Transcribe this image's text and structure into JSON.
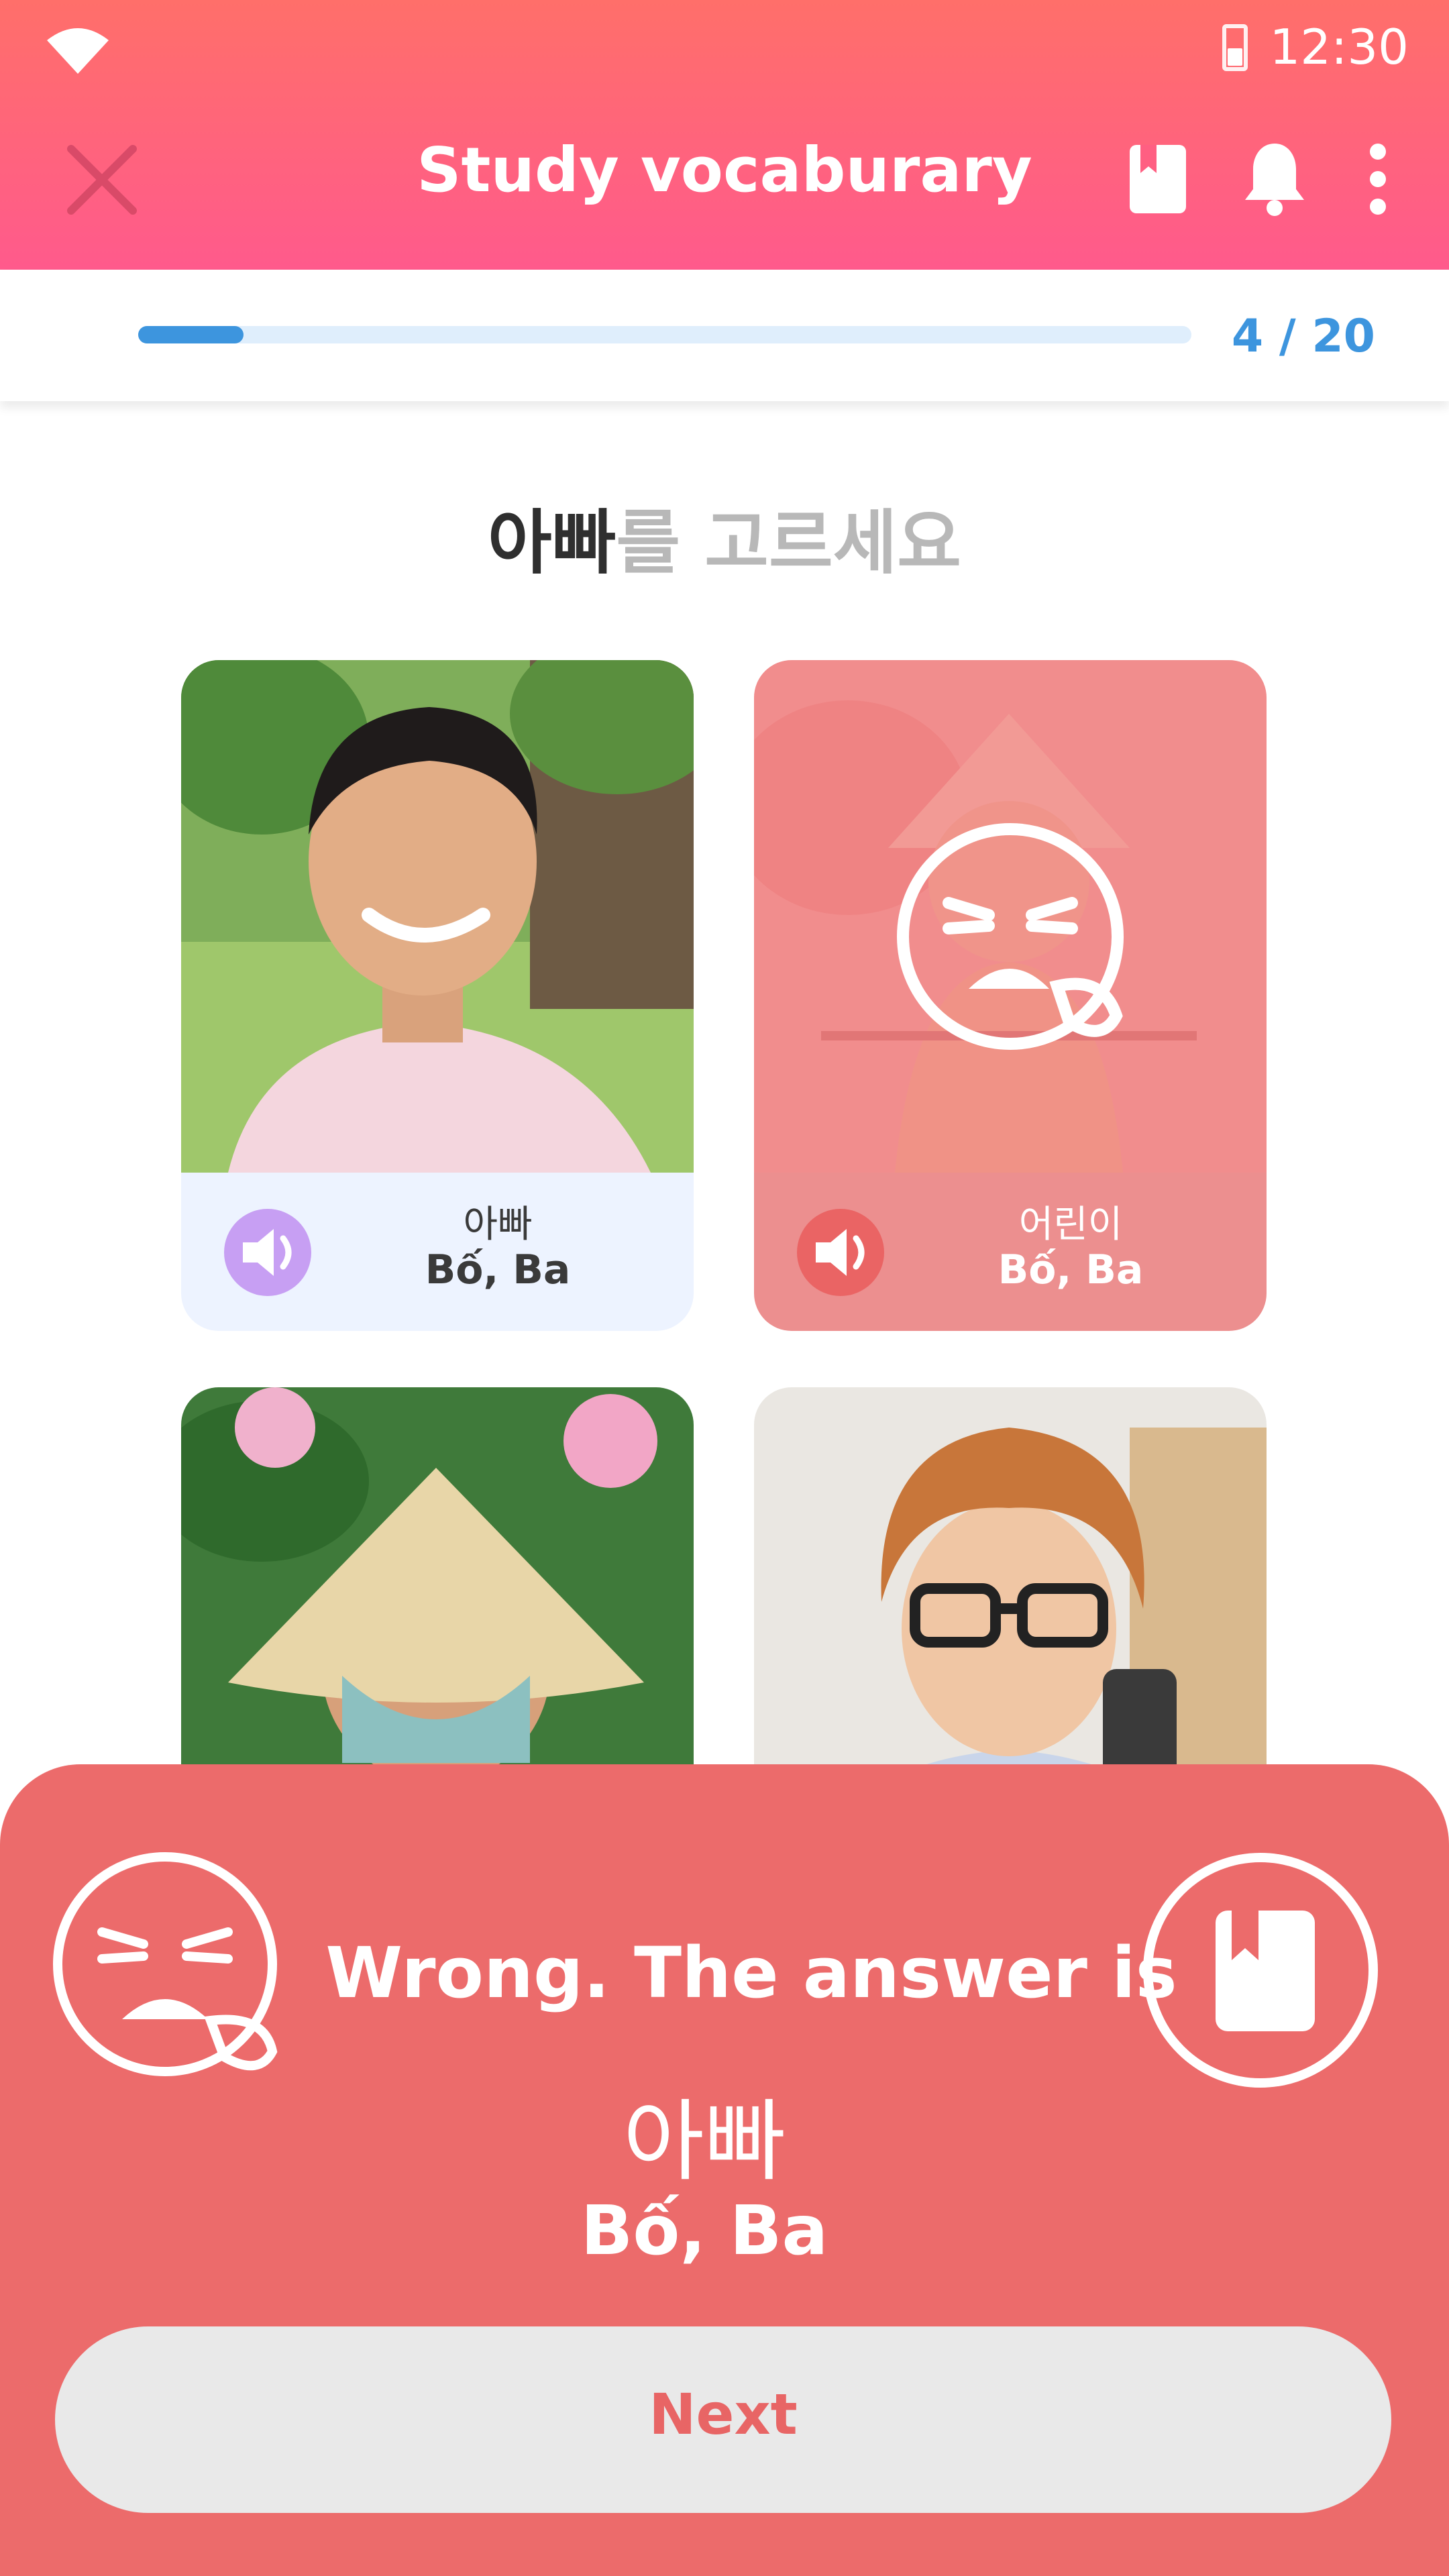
{
  "status_bar": {
    "time": "12:30",
    "wifi_icon": "wifi-icon",
    "battery_icon": "battery-icon"
  },
  "header": {
    "title": "Study vocaburary",
    "close_icon": "close-icon",
    "bookmark_icon": "bookmark-icon",
    "bell_icon": "bell-icon",
    "more_icon": "more-vertical-icon",
    "gradient": [
      "#ff6f6a",
      "#ff5a8c"
    ]
  },
  "progress": {
    "current": 4,
    "total": 20,
    "text": "4 / 20",
    "fraction": 0.2
  },
  "question": {
    "word": "아빠",
    "rest": "를 고르세요"
  },
  "cards": [
    {
      "id": "father",
      "label_ko": "아빠",
      "label_vi": "Bố, Ba",
      "state": "normal",
      "speaker_icon": "speaker-icon"
    },
    {
      "id": "child",
      "label_ko": "어린이",
      "label_vi": "Bố, Ba",
      "state": "wrong",
      "speaker_icon": "speaker-icon",
      "overlay_icon": "sad-face-icon"
    },
    {
      "id": "woman-conical-hat",
      "state": "normal"
    },
    {
      "id": "young-man-glasses",
      "state": "normal"
    }
  ],
  "feedback": {
    "message": "Wrong. The answer is",
    "answer_ko": "아빠",
    "answer_vi": "Bố, Ba",
    "left_icon": "sad-face-icon",
    "right_icon": "bookmark-icon",
    "next_label": "Next"
  },
  "colors": {
    "accent": "#3d95de",
    "wrong": "#ec6b6b",
    "speaker_purple": "#c79ff3"
  }
}
